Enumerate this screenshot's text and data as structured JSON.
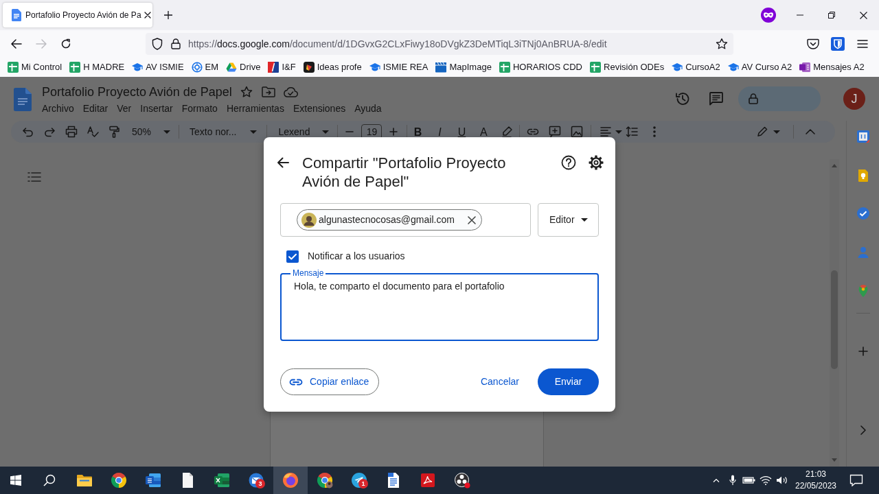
{
  "browser": {
    "tabs": [
      {
        "title": "Portafolio Proyecto Avión de Pa",
        "selected": true
      }
    ],
    "forward_disabled": true,
    "url": {
      "scheme": "https://",
      "host": "docs.google.com",
      "path": "/document/d/1DGvxG2CLxFiwy18oDVgkZ3DeMTiqL3iTNj0AnBRUA-8/edit"
    },
    "bookmarks": [
      {
        "label": "Mi Control",
        "kind": "sheet"
      },
      {
        "label": "H MADRE",
        "kind": "sheet"
      },
      {
        "label": "AV ISMIE",
        "kind": "cap"
      },
      {
        "label": "EM",
        "kind": "ring"
      },
      {
        "label": "Drive",
        "kind": "drive"
      },
      {
        "label": "I&F",
        "kind": "split"
      },
      {
        "label": "Ideas profe",
        "kind": "app"
      },
      {
        "label": "ISMIE REA",
        "kind": "cap"
      },
      {
        "label": "MapImage",
        "kind": "clapper"
      },
      {
        "label": "HORARIOS CDD",
        "kind": "sheet"
      },
      {
        "label": "Revisión ODEs",
        "kind": "sheet"
      },
      {
        "label": "CursoA2",
        "kind": "cap"
      },
      {
        "label": "AV Curso A2",
        "kind": "cap"
      },
      {
        "label": "Mensajes A2",
        "kind": "notebook"
      }
    ]
  },
  "docs": {
    "title": "Portafolio Proyecto Avión de Papel",
    "menu": [
      "Archivo",
      "Editar",
      "Ver",
      "Insertar",
      "Formato",
      "Herramientas",
      "Extensiones",
      "Ayuda"
    ],
    "avatar": "J",
    "toolbar": {
      "zoom": "50%",
      "style": "Texto nor...",
      "font": "Lexend",
      "font_size": "19",
      "format": [
        {
          "label": "B",
          "kind": "bold"
        },
        {
          "label": "I",
          "kind": "italic"
        },
        {
          "label": "U",
          "kind": "underline"
        },
        {
          "label": "A",
          "kind": "color"
        }
      ]
    }
  },
  "share_dialog": {
    "title": "Compartir \"Portafolio Proyecto Avión de Papel\"",
    "recipients": [
      {
        "email": "algunastecnocosas@gmail.com"
      }
    ],
    "role": "Editor",
    "notify": {
      "label": "Notificar a los usuarios",
      "checked": true
    },
    "message": {
      "label": "Mensaje",
      "value": "Hola, te comparto el documento para el portafolio"
    },
    "buttons": {
      "copy_link": "Copiar enlace",
      "cancel": "Cancelar",
      "send": "Enviar"
    }
  },
  "taskbar": {
    "apps": [
      {
        "kind": "folder",
        "selected": false
      },
      {
        "kind": "chrome",
        "selected": false
      },
      {
        "kind": "word",
        "selected": false
      },
      {
        "kind": "file",
        "selected": false
      },
      {
        "kind": "excel",
        "selected": false
      },
      {
        "kind": "mail",
        "badge": "3",
        "selected": false
      },
      {
        "kind": "firefox",
        "selected": true
      },
      {
        "kind": "chrome_profile",
        "selected": false
      },
      {
        "kind": "telegram",
        "badge": "1",
        "selected": false
      },
      {
        "kind": "writer",
        "selected": false
      },
      {
        "kind": "acrobat",
        "selected": false
      },
      {
        "kind": "obs",
        "selected": false
      }
    ],
    "time": "21:03",
    "date": "22/05/2023"
  }
}
